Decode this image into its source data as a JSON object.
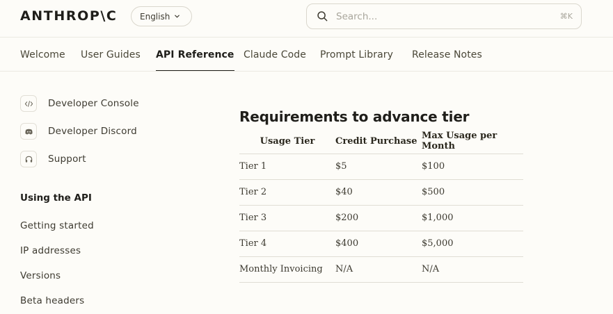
{
  "header": {
    "logo_text": "ANTHROP\\C",
    "language": "English",
    "search_placeholder": "Search...",
    "search_shortcut": "⌘K"
  },
  "tabs": [
    {
      "label": "Welcome"
    },
    {
      "label": "User Guides"
    },
    {
      "label": "API Reference",
      "active": true
    },
    {
      "label": "Claude Code"
    },
    {
      "label": "Prompt Library"
    },
    {
      "label": "Release Notes"
    }
  ],
  "sidebar": {
    "links": [
      {
        "label": "Developer Console",
        "icon": "code-icon"
      },
      {
        "label": "Developer Discord",
        "icon": "discord-icon"
      },
      {
        "label": "Support",
        "icon": "headset-icon"
      }
    ],
    "section_heading": "Using the API",
    "items": [
      {
        "label": "Getting started"
      },
      {
        "label": "IP addresses"
      },
      {
        "label": "Versions"
      },
      {
        "label": "Beta headers"
      }
    ]
  },
  "main": {
    "section_title": "Requirements to advance tier",
    "table": {
      "headers": [
        "Usage Tier",
        "Credit Purchase",
        "Max Usage per Month"
      ],
      "rows": [
        [
          "Tier 1",
          "$5",
          "$100"
        ],
        [
          "Tier 2",
          "$40",
          "$500"
        ],
        [
          "Tier 3",
          "$200",
          "$1,000"
        ],
        [
          "Tier 4",
          "$400",
          "$5,000"
        ],
        [
          "Monthly Invoicing",
          "N/A",
          "N/A"
        ]
      ]
    }
  },
  "colors": {
    "background": "#fdfcf8",
    "text": "#29261b",
    "border": "#e0ddd4"
  }
}
